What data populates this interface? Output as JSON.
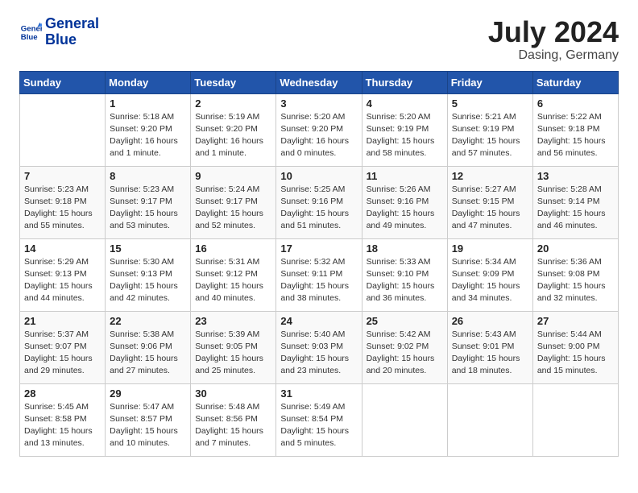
{
  "header": {
    "logo_line1": "General",
    "logo_line2": "Blue",
    "title": "July 2024",
    "location": "Dasing, Germany"
  },
  "weekdays": [
    "Sunday",
    "Monday",
    "Tuesday",
    "Wednesday",
    "Thursday",
    "Friday",
    "Saturday"
  ],
  "weeks": [
    [
      {
        "day": "",
        "info": ""
      },
      {
        "day": "1",
        "info": "Sunrise: 5:18 AM\nSunset: 9:20 PM\nDaylight: 16 hours\nand 1 minute."
      },
      {
        "day": "2",
        "info": "Sunrise: 5:19 AM\nSunset: 9:20 PM\nDaylight: 16 hours\nand 1 minute."
      },
      {
        "day": "3",
        "info": "Sunrise: 5:20 AM\nSunset: 9:20 PM\nDaylight: 16 hours\nand 0 minutes."
      },
      {
        "day": "4",
        "info": "Sunrise: 5:20 AM\nSunset: 9:19 PM\nDaylight: 15 hours\nand 58 minutes."
      },
      {
        "day": "5",
        "info": "Sunrise: 5:21 AM\nSunset: 9:19 PM\nDaylight: 15 hours\nand 57 minutes."
      },
      {
        "day": "6",
        "info": "Sunrise: 5:22 AM\nSunset: 9:18 PM\nDaylight: 15 hours\nand 56 minutes."
      }
    ],
    [
      {
        "day": "7",
        "info": "Sunrise: 5:23 AM\nSunset: 9:18 PM\nDaylight: 15 hours\nand 55 minutes."
      },
      {
        "day": "8",
        "info": "Sunrise: 5:23 AM\nSunset: 9:17 PM\nDaylight: 15 hours\nand 53 minutes."
      },
      {
        "day": "9",
        "info": "Sunrise: 5:24 AM\nSunset: 9:17 PM\nDaylight: 15 hours\nand 52 minutes."
      },
      {
        "day": "10",
        "info": "Sunrise: 5:25 AM\nSunset: 9:16 PM\nDaylight: 15 hours\nand 51 minutes."
      },
      {
        "day": "11",
        "info": "Sunrise: 5:26 AM\nSunset: 9:16 PM\nDaylight: 15 hours\nand 49 minutes."
      },
      {
        "day": "12",
        "info": "Sunrise: 5:27 AM\nSunset: 9:15 PM\nDaylight: 15 hours\nand 47 minutes."
      },
      {
        "day": "13",
        "info": "Sunrise: 5:28 AM\nSunset: 9:14 PM\nDaylight: 15 hours\nand 46 minutes."
      }
    ],
    [
      {
        "day": "14",
        "info": "Sunrise: 5:29 AM\nSunset: 9:13 PM\nDaylight: 15 hours\nand 44 minutes."
      },
      {
        "day": "15",
        "info": "Sunrise: 5:30 AM\nSunset: 9:13 PM\nDaylight: 15 hours\nand 42 minutes."
      },
      {
        "day": "16",
        "info": "Sunrise: 5:31 AM\nSunset: 9:12 PM\nDaylight: 15 hours\nand 40 minutes."
      },
      {
        "day": "17",
        "info": "Sunrise: 5:32 AM\nSunset: 9:11 PM\nDaylight: 15 hours\nand 38 minutes."
      },
      {
        "day": "18",
        "info": "Sunrise: 5:33 AM\nSunset: 9:10 PM\nDaylight: 15 hours\nand 36 minutes."
      },
      {
        "day": "19",
        "info": "Sunrise: 5:34 AM\nSunset: 9:09 PM\nDaylight: 15 hours\nand 34 minutes."
      },
      {
        "day": "20",
        "info": "Sunrise: 5:36 AM\nSunset: 9:08 PM\nDaylight: 15 hours\nand 32 minutes."
      }
    ],
    [
      {
        "day": "21",
        "info": "Sunrise: 5:37 AM\nSunset: 9:07 PM\nDaylight: 15 hours\nand 29 minutes."
      },
      {
        "day": "22",
        "info": "Sunrise: 5:38 AM\nSunset: 9:06 PM\nDaylight: 15 hours\nand 27 minutes."
      },
      {
        "day": "23",
        "info": "Sunrise: 5:39 AM\nSunset: 9:05 PM\nDaylight: 15 hours\nand 25 minutes."
      },
      {
        "day": "24",
        "info": "Sunrise: 5:40 AM\nSunset: 9:03 PM\nDaylight: 15 hours\nand 23 minutes."
      },
      {
        "day": "25",
        "info": "Sunrise: 5:42 AM\nSunset: 9:02 PM\nDaylight: 15 hours\nand 20 minutes."
      },
      {
        "day": "26",
        "info": "Sunrise: 5:43 AM\nSunset: 9:01 PM\nDaylight: 15 hours\nand 18 minutes."
      },
      {
        "day": "27",
        "info": "Sunrise: 5:44 AM\nSunset: 9:00 PM\nDaylight: 15 hours\nand 15 minutes."
      }
    ],
    [
      {
        "day": "28",
        "info": "Sunrise: 5:45 AM\nSunset: 8:58 PM\nDaylight: 15 hours\nand 13 minutes."
      },
      {
        "day": "29",
        "info": "Sunrise: 5:47 AM\nSunset: 8:57 PM\nDaylight: 15 hours\nand 10 minutes."
      },
      {
        "day": "30",
        "info": "Sunrise: 5:48 AM\nSunset: 8:56 PM\nDaylight: 15 hours\nand 7 minutes."
      },
      {
        "day": "31",
        "info": "Sunrise: 5:49 AM\nSunset: 8:54 PM\nDaylight: 15 hours\nand 5 minutes."
      },
      {
        "day": "",
        "info": ""
      },
      {
        "day": "",
        "info": ""
      },
      {
        "day": "",
        "info": ""
      }
    ]
  ]
}
